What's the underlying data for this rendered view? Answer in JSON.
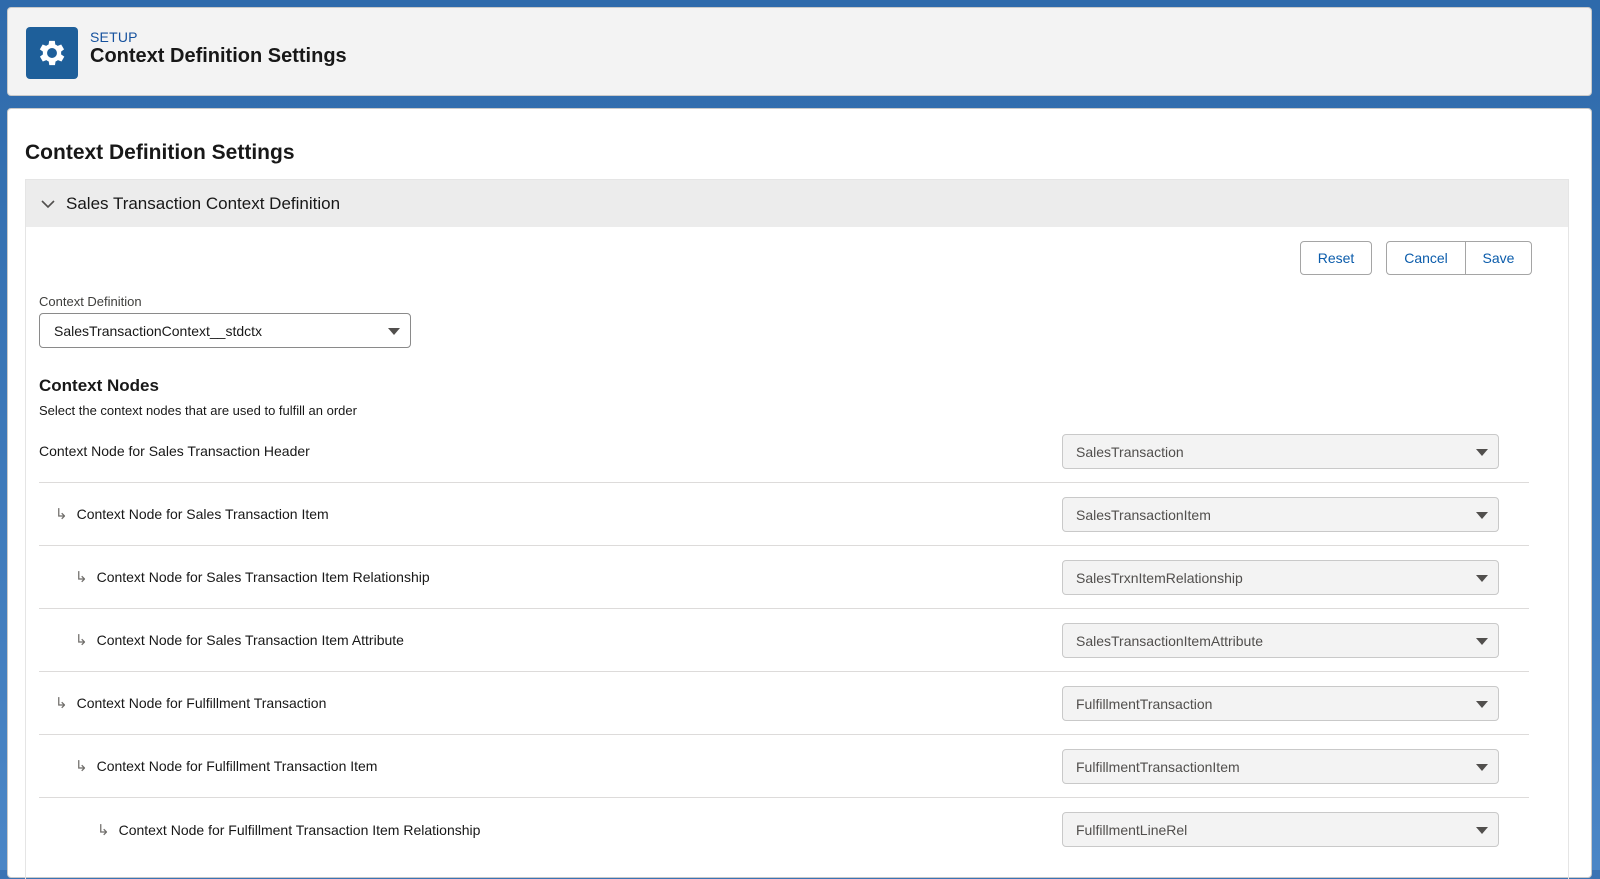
{
  "header": {
    "eyebrow": "SETUP",
    "title": "Context Definition Settings",
    "icon": "gear-icon"
  },
  "page": {
    "title": "Context Definition Settings"
  },
  "section": {
    "title": "Sales Transaction Context Definition",
    "icon": "chevron-down-icon"
  },
  "buttons": {
    "reset": "Reset",
    "cancel": "Cancel",
    "save": "Save"
  },
  "context_definition": {
    "label": "Context Definition",
    "value": "SalesTransactionContext__stdctx"
  },
  "context_nodes": {
    "title": "Context Nodes",
    "subtitle": "Select the context nodes that are used to fulfill an order",
    "rows": [
      {
        "label": "Context Node for Sales Transaction Header",
        "value": "SalesTransaction",
        "indent_level": 0
      },
      {
        "label": "Context Node for Sales Transaction Item",
        "value": "SalesTransactionItem",
        "indent_level": 1
      },
      {
        "label": "Context Node for Sales Transaction Item Relationship",
        "value": "SalesTrxnItemRelationship",
        "indent_level": 2
      },
      {
        "label": "Context Node for Sales Transaction Item Attribute",
        "value": "SalesTransactionItemAttribute",
        "indent_level": 2
      },
      {
        "label": "Context Node for Fulfillment Transaction",
        "value": "FulfillmentTransaction",
        "indent_level": 1
      },
      {
        "label": "Context Node for Fulfillment Transaction Item",
        "value": "FulfillmentTransactionItem",
        "indent_level": 2
      },
      {
        "label": "Context Node for Fulfillment Transaction Item Relationship",
        "value": "FulfillmentLineRel",
        "indent_level": 3
      }
    ]
  },
  "colors": {
    "brand_blue": "#0b5cab",
    "header_tile": "#1e5f9a"
  }
}
